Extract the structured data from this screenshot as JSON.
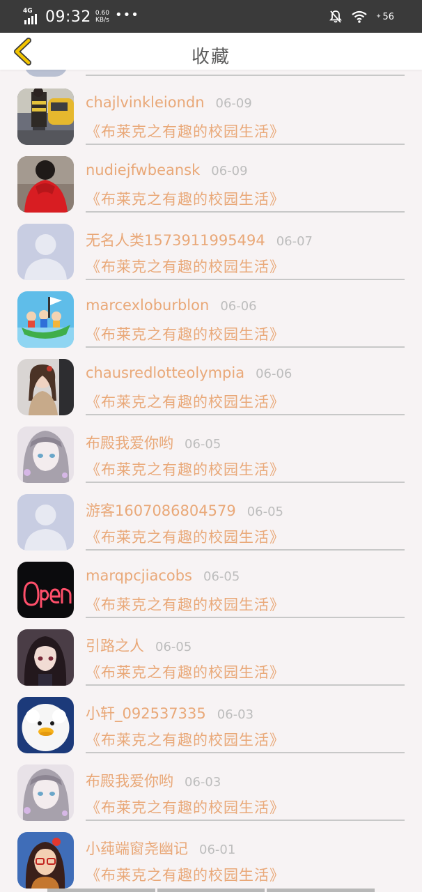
{
  "status_bar": {
    "network": "4G",
    "time": "09:32",
    "speed_value": "0.60",
    "speed_unit": "KB/s",
    "more": "•••",
    "battery": "56"
  },
  "header": {
    "title": "收藏",
    "back_icon": "chevron-left-icon",
    "accent": "#f2c400"
  },
  "colors": {
    "name": "#e9a878",
    "date": "#bdbdbd",
    "divider": "#c8c8c8",
    "background": "#f7f3f4"
  },
  "favorites": [
    {
      "user": "chajlvinkleiondn",
      "date": "06-09",
      "title": "《布莱克之有趣的校园生活》",
      "avatar": "photo-person-taxi"
    },
    {
      "user": "nudiejfwbeansk",
      "date": "06-09",
      "title": "《布莱克之有趣的校园生活》",
      "avatar": "photo-red-hoodie"
    },
    {
      "user": "无名人类1573911995494",
      "date": "06-07",
      "title": "《布莱克之有趣的校园生活》",
      "avatar": "default-silhouette"
    },
    {
      "user": "marcexloburblon",
      "date": "06-06",
      "title": "《布莱克之有趣的校园生活》",
      "avatar": "cartoon-boat"
    },
    {
      "user": "chausredlotteolympia",
      "date": "06-06",
      "title": "《布莱克之有趣的校园生活》",
      "avatar": "photo-girl"
    },
    {
      "user": "布殿我爱你哟",
      "date": "06-05",
      "title": "《布莱克之有趣的校园生活》",
      "avatar": "anime-girl-pale"
    },
    {
      "user": "游客1607086804579",
      "date": "06-05",
      "title": "《布莱克之有趣的校园生活》",
      "avatar": "default-silhouette"
    },
    {
      "user": "marqpcjiacobs",
      "date": "06-05",
      "title": "《布莱克之有趣的校园生活》",
      "avatar": "neon-open-sign"
    },
    {
      "user": "引路之人",
      "date": "06-05",
      "title": "《布莱克之有趣的校园生活》",
      "avatar": "anime-girl-dark"
    },
    {
      "user": "小轩_092537335",
      "date": "06-03",
      "title": "《布莱克之有趣的校园生活》",
      "avatar": "duck-plush"
    },
    {
      "user": "布殿我爱你哟",
      "date": "06-03",
      "title": "《布莱克之有趣的校园生活》",
      "avatar": "anime-girl-pale"
    },
    {
      "user": "小莼端窗尧幽记",
      "date": "06-01",
      "title": "《布莱克之有趣的校园生活》",
      "avatar": "cartoon-glasses-girl"
    }
  ]
}
